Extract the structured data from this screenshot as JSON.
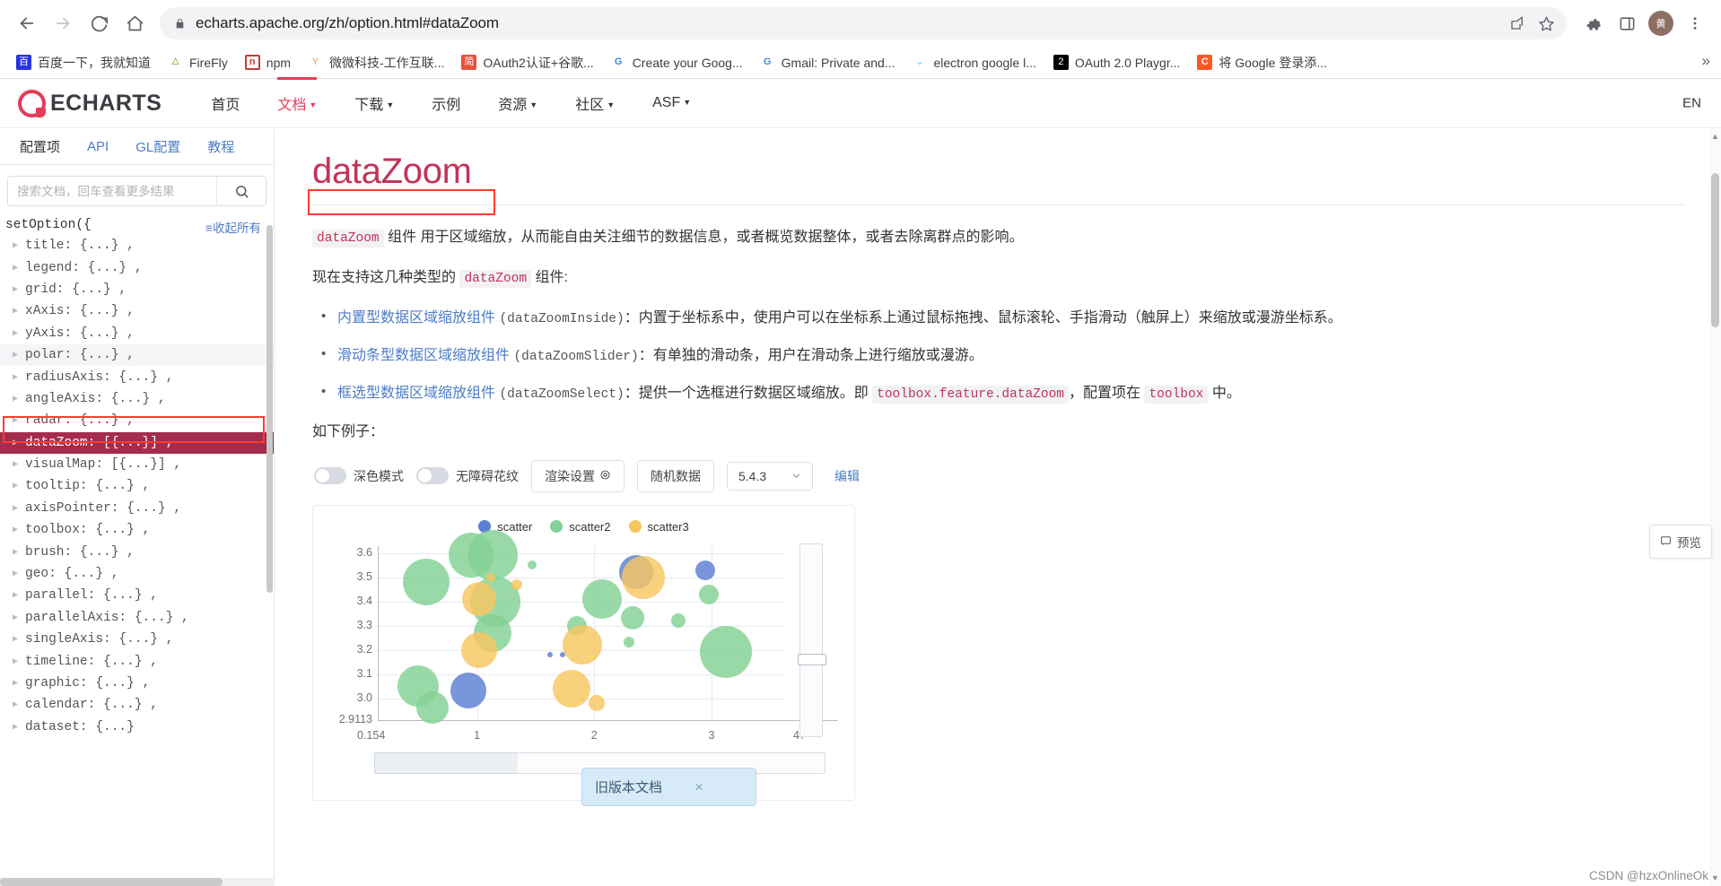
{
  "browser": {
    "back_icon": "back-arrow-icon",
    "forward_icon": "forward-arrow-icon",
    "reload_icon": "reload-icon",
    "home_icon": "home-icon",
    "url": "echarts.apache.org/zh/option.html#dataZoom",
    "url_domain": "echarts.apache.org",
    "url_path": "/zh/option.html#dataZoom",
    "lock_icon": "lock-icon",
    "share_icon": "share-icon",
    "bookmark_icon": "star-icon",
    "extensions_icon": "puzzle-piece-icon",
    "sidepanel_icon": "side-panel-icon",
    "avatar_label": "黄",
    "menu_icon": "three-dot-menu-icon",
    "bookmarks": [
      {
        "label": "百度一下，我就知道",
        "icon": "baidu-favicon",
        "glyph": "百"
      },
      {
        "label": "FireFly",
        "icon": "firefly-favicon",
        "glyph": "🜂"
      },
      {
        "label": "npm",
        "icon": "npm-favicon",
        "glyph": "n"
      },
      {
        "label": "微微科技-工作互联...",
        "icon": "weiwei-favicon",
        "glyph": "Y"
      },
      {
        "label": "OAuth2认证+谷歌...",
        "icon": "oauth2-favicon",
        "glyph": "简"
      },
      {
        "label": "Create your Goog...",
        "icon": "google-favicon",
        "glyph": "G"
      },
      {
        "label": "Gmail: Private and...",
        "icon": "google-favicon",
        "glyph": "G"
      },
      {
        "label": "electron google l...",
        "icon": "electron-favicon",
        "glyph": "⌄"
      },
      {
        "label": "OAuth 2.0 Playgr...",
        "icon": "oauth-playground-favicon",
        "glyph": "2"
      },
      {
        "label": "将 Google 登录添...",
        "icon": "c-favicon",
        "glyph": "C"
      }
    ],
    "bookmarks_overflow": "»"
  },
  "site": {
    "logo_text": "ECHARTS",
    "nav": [
      {
        "label": "首页",
        "has_caret": false,
        "active": false
      },
      {
        "label": "文档",
        "has_caret": true,
        "active": true
      },
      {
        "label": "下载",
        "has_caret": true,
        "active": false
      },
      {
        "label": "示例",
        "has_caret": false,
        "active": false
      },
      {
        "label": "资源",
        "has_caret": true,
        "active": false
      },
      {
        "label": "社区",
        "has_caret": true,
        "active": false
      },
      {
        "label": "ASF",
        "has_caret": true,
        "active": false
      }
    ],
    "lang_switch": "EN"
  },
  "sidebar": {
    "tabs": [
      {
        "label": "配置项",
        "active": true
      },
      {
        "label": "API",
        "active": false
      },
      {
        "label": "GL配置",
        "active": false
      },
      {
        "label": "教程",
        "active": false
      }
    ],
    "search_placeholder": "搜索文档，回车查看更多结果",
    "search_value": "",
    "search_icon": "search-icon",
    "tree_root": "setOption({",
    "collapse_all": "≡收起所有",
    "items": [
      {
        "label": "title: {...} ,",
        "state": "normal"
      },
      {
        "label": "legend: {...} ,",
        "state": "normal"
      },
      {
        "label": "grid: {...} ,",
        "state": "normal"
      },
      {
        "label": "xAxis: {...} ,",
        "state": "normal"
      },
      {
        "label": "yAxis: {...} ,",
        "state": "normal"
      },
      {
        "label": "polar: {...} ,",
        "state": "hovered"
      },
      {
        "label": "radiusAxis: {...} ,",
        "state": "normal"
      },
      {
        "label": "angleAxis: {...} ,",
        "state": "normal"
      },
      {
        "label": "radar: {...} ,",
        "state": "normal"
      },
      {
        "label": "dataZoom: [{...}] ,",
        "state": "selected"
      },
      {
        "label": "visualMap: [{...}] ,",
        "state": "normal"
      },
      {
        "label": "tooltip: {...} ,",
        "state": "normal"
      },
      {
        "label": "axisPointer: {...} ,",
        "state": "normal"
      },
      {
        "label": "toolbox: {...} ,",
        "state": "normal"
      },
      {
        "label": "brush: {...} ,",
        "state": "normal"
      },
      {
        "label": "geo: {...} ,",
        "state": "normal"
      },
      {
        "label": "parallel: {...} ,",
        "state": "normal"
      },
      {
        "label": "parallelAxis: {...} ,",
        "state": "normal"
      },
      {
        "label": "singleAxis: {...} ,",
        "state": "normal"
      },
      {
        "label": "timeline: {...} ,",
        "state": "normal"
      },
      {
        "label": "graphic: {...} ,",
        "state": "normal"
      },
      {
        "label": "calendar: {...} ,",
        "state": "normal"
      },
      {
        "label": "dataset: {...}",
        "state": "normal"
      }
    ]
  },
  "main": {
    "title": "dataZoom",
    "intro": {
      "code": "dataZoom",
      "rest": " 组件 用于区域缩放，从而能自由关注细节的数据信息，或者概览数据整体，或者去除离群点的影响。"
    },
    "types_line": {
      "before": "现在支持这几种类型的 ",
      "code": "dataZoom",
      "after": " 组件:"
    },
    "bullets": [
      {
        "link": "内置型数据区域缩放组件",
        "code": "(dataZoomInside)",
        "text": "：内置于坐标系中，使用户可以在坐标系上通过鼠标拖拽、鼠标滚轮、手指滑动（触屏上）来缩放或漫游坐标系。"
      },
      {
        "link": "滑动条型数据区域缩放组件",
        "code": "(dataZoomSlider)",
        "text": "：有单独的滑动条，用户在滑动条上进行缩放或漫游。"
      },
      {
        "link": "框选型数据区域缩放组件",
        "code": "(dataZoomSelect)",
        "text": "：提供一个选框进行数据区域缩放。即 ",
        "code2": "toolbox.feature.dataZoom",
        "text2": "，配置项在 ",
        "code3": "toolbox",
        "text3": " 中。"
      }
    ],
    "example_line": "如下例子：",
    "preview_button": "预览",
    "preview_icon": "preview-icon"
  },
  "demo_toolbar": {
    "dark_mode_label": "深色模式",
    "dark_mode_on": false,
    "pattern_label": "无障碍花纹",
    "pattern_on": false,
    "render_settings": "渲染设置",
    "render_settings_icon": "gear-icon",
    "random_data": "随机数据",
    "version": "5.4.3",
    "version_caret_icon": "chevron-down-icon",
    "edit_link": "编辑"
  },
  "legacy_toast": {
    "text": "旧版本文档",
    "close_icon": "close-icon"
  },
  "watermark": "CSDN @hzxOnlineOk",
  "colors": {
    "brand_red": "#e43c59",
    "title_red": "#c1335a",
    "selected_bg": "#a42c4d",
    "link_blue": "#4d7cc7",
    "annotation_red": "#fd3b30",
    "scatter": "#5b7fd4",
    "scatter2": "#83d194",
    "scatter3": "#f6c760"
  },
  "chart_data": {
    "type": "scatter",
    "title": "",
    "legend": [
      "scatter",
      "scatter2",
      "scatter3"
    ],
    "legend_position": "top",
    "xlabel": "",
    "ylabel": "",
    "xticks": [
      "0.154",
      "1",
      "2",
      "3",
      "47"
    ],
    "yticks": [
      "2.9113",
      "3.0",
      "3.1",
      "3.2",
      "3.3",
      "3.4",
      "3.5",
      "3.6"
    ],
    "xlim": [
      0.154,
      3.6
    ],
    "ylim": [
      2.9113,
      3.6
    ],
    "grid": true,
    "has_datazoom_slider": true,
    "series": [
      {
        "name": "scatter",
        "color": "#5b7fd4",
        "points": [
          {
            "x": 2.36,
            "y": 3.52,
            "size": 38
          },
          {
            "x": 2.95,
            "y": 3.53,
            "size": 22
          },
          {
            "x": 0.93,
            "y": 3.03,
            "size": 40
          },
          {
            "x": 1.62,
            "y": 3.18,
            "size": 6
          },
          {
            "x": 1.73,
            "y": 3.18,
            "size": 6
          }
        ]
      },
      {
        "name": "scatter2",
        "color": "#83d194",
        "points": [
          {
            "x": 0.95,
            "y": 3.59,
            "size": 50
          },
          {
            "x": 1.13,
            "y": 3.59,
            "size": 56
          },
          {
            "x": 0.57,
            "y": 3.48,
            "size": 52
          },
          {
            "x": 1.47,
            "y": 3.55,
            "size": 10
          },
          {
            "x": 1.16,
            "y": 3.4,
            "size": 56
          },
          {
            "x": 2.07,
            "y": 3.41,
            "size": 44
          },
          {
            "x": 2.33,
            "y": 3.33,
            "size": 26
          },
          {
            "x": 2.72,
            "y": 3.32,
            "size": 16
          },
          {
            "x": 1.13,
            "y": 3.27,
            "size": 42
          },
          {
            "x": 1.85,
            "y": 3.3,
            "size": 22
          },
          {
            "x": 3.12,
            "y": 3.19,
            "size": 58
          },
          {
            "x": 2.3,
            "y": 3.23,
            "size": 12
          },
          {
            "x": 0.5,
            "y": 3.05,
            "size": 46
          },
          {
            "x": 0.62,
            "y": 2.96,
            "size": 36
          },
          {
            "x": 2.98,
            "y": 3.43,
            "size": 22
          }
        ]
      },
      {
        "name": "scatter3",
        "color": "#f6c760",
        "points": [
          {
            "x": 1.02,
            "y": 3.41,
            "size": 38
          },
          {
            "x": 1.34,
            "y": 3.47,
            "size": 12
          },
          {
            "x": 1.12,
            "y": 3.5,
            "size": 10
          },
          {
            "x": 1.02,
            "y": 3.2,
            "size": 40
          },
          {
            "x": 1.9,
            "y": 3.22,
            "size": 44
          },
          {
            "x": 1.81,
            "y": 3.04,
            "size": 42
          },
          {
            "x": 2.42,
            "y": 3.5,
            "size": 48
          },
          {
            "x": 2.02,
            "y": 2.98,
            "size": 18
          }
        ]
      }
    ]
  }
}
